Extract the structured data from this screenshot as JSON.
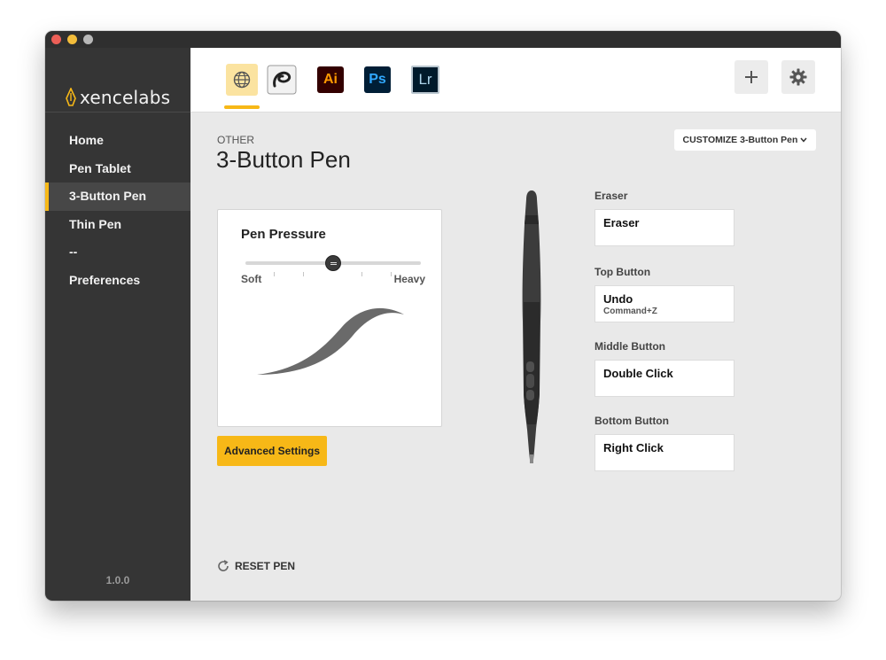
{
  "app": {
    "logo_text": "xencelabs",
    "version": "1.0.0",
    "accent_color": "#f7b817"
  },
  "sidebar": {
    "items": [
      {
        "label": "Home",
        "active": false
      },
      {
        "label": "Pen Tablet",
        "active": false
      },
      {
        "label": "3-Button Pen",
        "active": true
      },
      {
        "label": "Thin Pen",
        "active": false
      },
      {
        "label": "--",
        "active": false
      },
      {
        "label": "Preferences",
        "active": false
      }
    ]
  },
  "toolbar": {
    "app_tabs": [
      {
        "name": "global",
        "icon": "globe-icon",
        "selected": true
      },
      {
        "name": "Clip Studio Paint",
        "icon": "clip-studio-icon",
        "selected": false
      },
      {
        "name": "Illustrator",
        "text": "Ai",
        "selected": false
      },
      {
        "name": "Photoshop",
        "text": "Ps",
        "selected": false
      },
      {
        "name": "Lightroom",
        "text": "Lr",
        "selected": false
      }
    ],
    "add_icon": "plus-icon",
    "settings_icon": "gear-icon"
  },
  "page": {
    "kicker": "OTHER",
    "title": "3-Button Pen",
    "customize_label": "CUSTOMIZE 3-Button Pen"
  },
  "pressure": {
    "title": "Pen Pressure",
    "soft_label": "Soft",
    "heavy_label": "Heavy",
    "level": 0.5
  },
  "advanced_settings_label": "Advanced Settings",
  "reset_label": "RESET PEN",
  "buttons": [
    {
      "label": "Eraser",
      "value": "Eraser",
      "sub": ""
    },
    {
      "label": "Top Button",
      "value": "Undo",
      "sub": "Command+Z"
    },
    {
      "label": "Middle Button",
      "value": "Double Click",
      "sub": ""
    },
    {
      "label": "Bottom Button",
      "value": "Right Click",
      "sub": ""
    }
  ]
}
